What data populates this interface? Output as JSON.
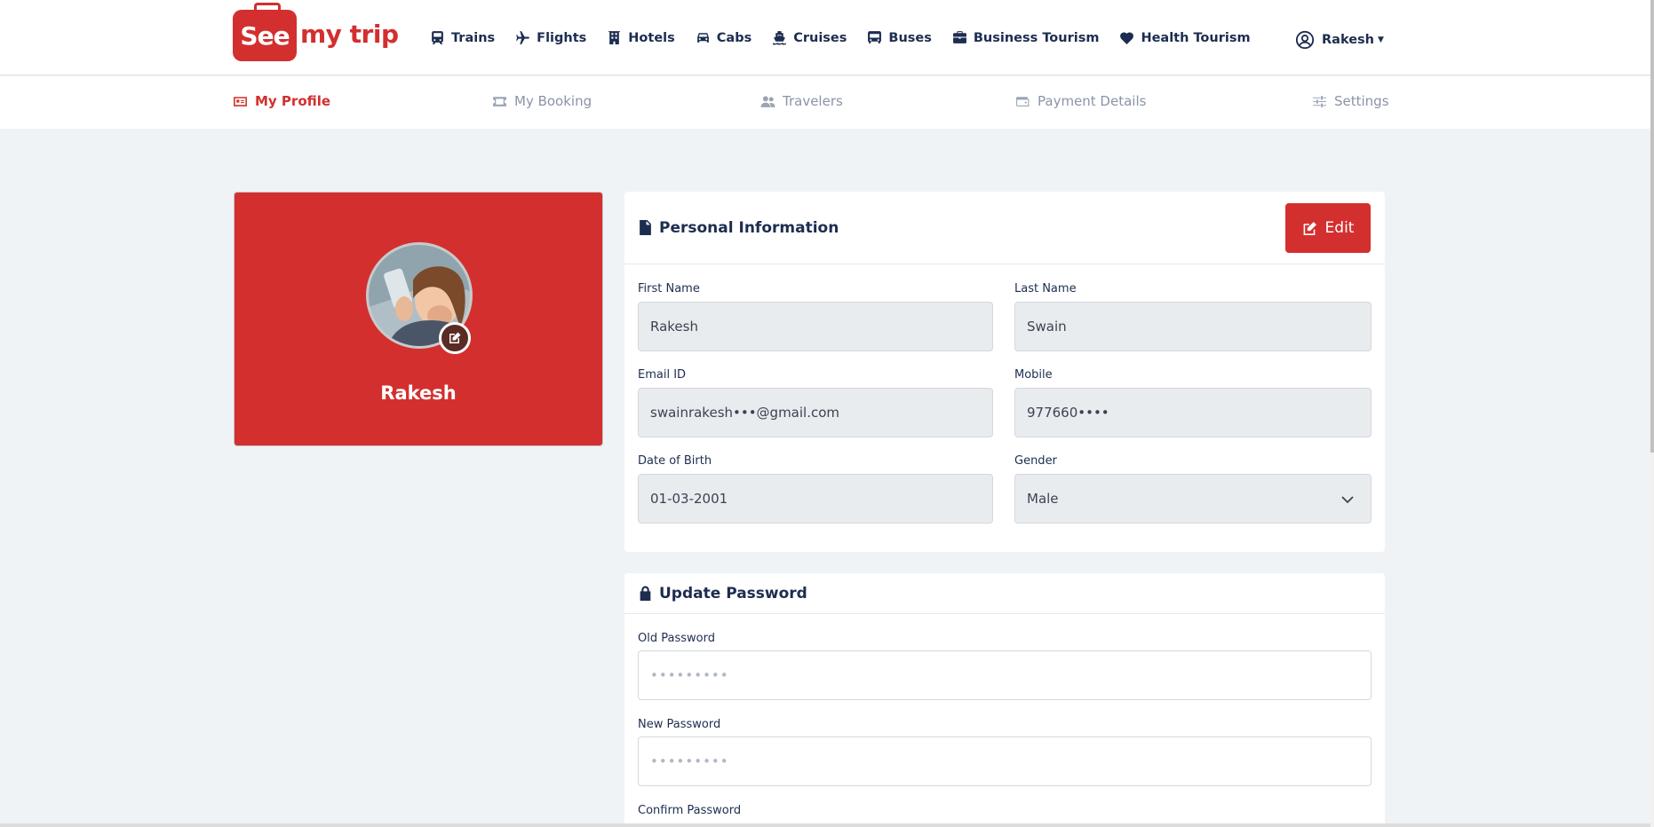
{
  "brand": {
    "logo_see": "See",
    "logo_rest": "my trip",
    "color": "#d32f2f"
  },
  "nav": {
    "items": [
      {
        "label": "Trains",
        "icon": "train-icon"
      },
      {
        "label": "Flights",
        "icon": "plane-icon"
      },
      {
        "label": "Hotels",
        "icon": "hotel-icon"
      },
      {
        "label": "Cabs",
        "icon": "car-icon"
      },
      {
        "label": "Cruises",
        "icon": "ship-icon"
      },
      {
        "label": "Buses",
        "icon": "bus-icon"
      },
      {
        "label": "Business Tourism",
        "icon": "briefcase-icon"
      },
      {
        "label": "Health Tourism",
        "icon": "heart-pulse-icon"
      }
    ],
    "user": "Rakesh"
  },
  "tabs": [
    {
      "label": "My Profile",
      "icon": "id-card-icon",
      "active": true
    },
    {
      "label": "My Booking",
      "icon": "ticket-icon",
      "active": false
    },
    {
      "label": "Travelers",
      "icon": "users-icon",
      "active": false
    },
    {
      "label": "Payment Details",
      "icon": "wallet-icon",
      "active": false
    },
    {
      "label": "Settings",
      "icon": "sliders-icon",
      "active": false
    }
  ],
  "profile": {
    "name": "Rakesh"
  },
  "personal": {
    "title": "Personal Information",
    "edit_label": "Edit",
    "first_name_label": "First Name",
    "first_name": "Rakesh",
    "last_name_label": "Last Name",
    "last_name": "Swain",
    "email_label": "Email ID",
    "email": "swainrakesh•••@gmail.com",
    "mobile_label": "Mobile",
    "mobile": "977660••••",
    "dob_label": "Date of Birth",
    "dob": "01-03-2001",
    "gender_label": "Gender",
    "gender": "Male"
  },
  "password": {
    "title": "Update Password",
    "old_label": "Old Password",
    "old_placeholder": "•••••••••",
    "new_label": "New Password",
    "new_placeholder": "•••••••••",
    "confirm_label": "Confirm Password"
  }
}
